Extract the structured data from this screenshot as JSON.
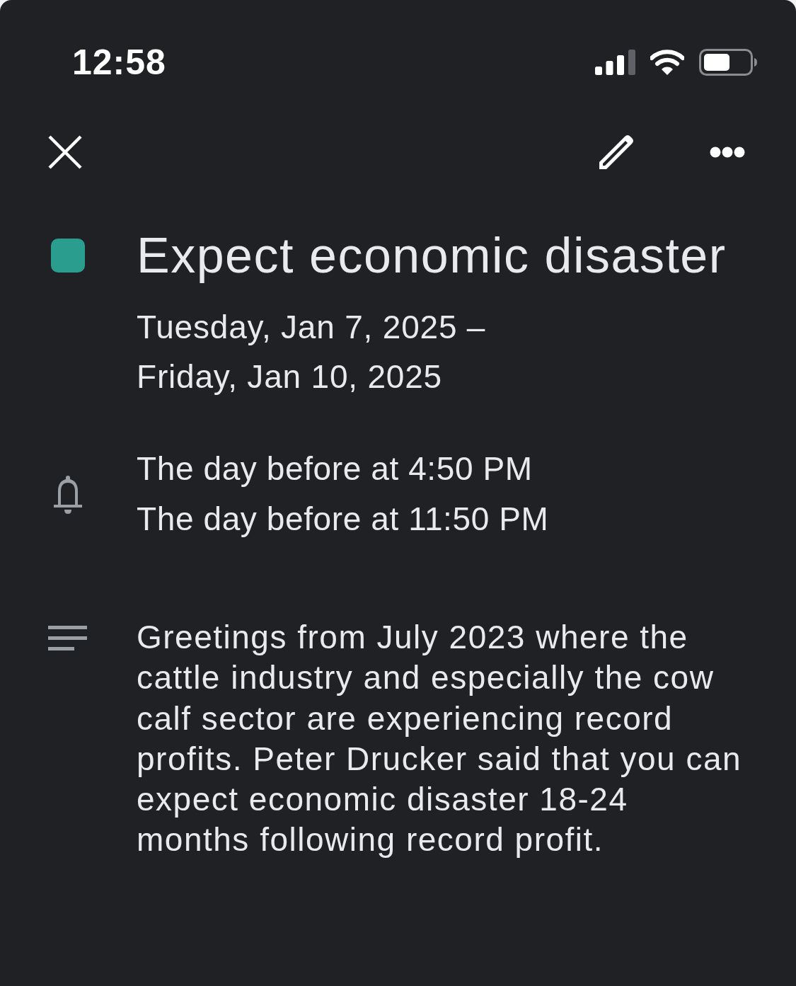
{
  "status_bar": {
    "time": "12:58"
  },
  "event": {
    "title": "Expect economic disaster",
    "color": "#2b9d8f",
    "date_lines": [
      "Tuesday, Jan 7, 2025 –",
      "Friday, Jan 10, 2025"
    ]
  },
  "reminders": [
    "The day before at 4:50 PM",
    "The day before at 11:50 PM"
  ],
  "description": "Greetings from July 2023 where the cattle industry and especially the cow calf sector are experiencing record profits. Peter Drucker said that you can expect economic disaster 18-24 months following record profit."
}
